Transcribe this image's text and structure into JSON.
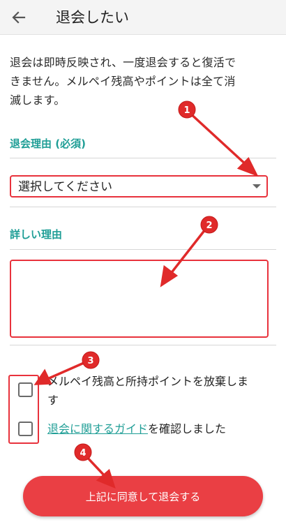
{
  "header": {
    "title": "退会したい",
    "back_icon": "back-arrow-icon"
  },
  "notice": {
    "text_line1": "退会は即時反映され、一度退会すると復活で",
    "text_line2": "きません。メルペイ残高やポイントは全て消",
    "text_line3": "滅します。"
  },
  "reason": {
    "label": "退会理由 (必須)",
    "select_value": "選択してください"
  },
  "detail": {
    "label": "詳しい理由",
    "value": ""
  },
  "checks": {
    "forfeit_line1": "メルペイ残高と所持ポイントを放棄しま",
    "forfeit_line2": "す",
    "guide_link": "退会に関するガイド",
    "guide_suffix": "を確認しました"
  },
  "submit": {
    "label": "上記に同意して退会する"
  },
  "annotations": {
    "badges": [
      "1",
      "2",
      "3",
      "4"
    ],
    "color": "#e02a2a"
  },
  "colors": {
    "accent_teal": "#1f9e96",
    "highlight_red": "#e8323c",
    "button_red": "#ea3f44"
  }
}
